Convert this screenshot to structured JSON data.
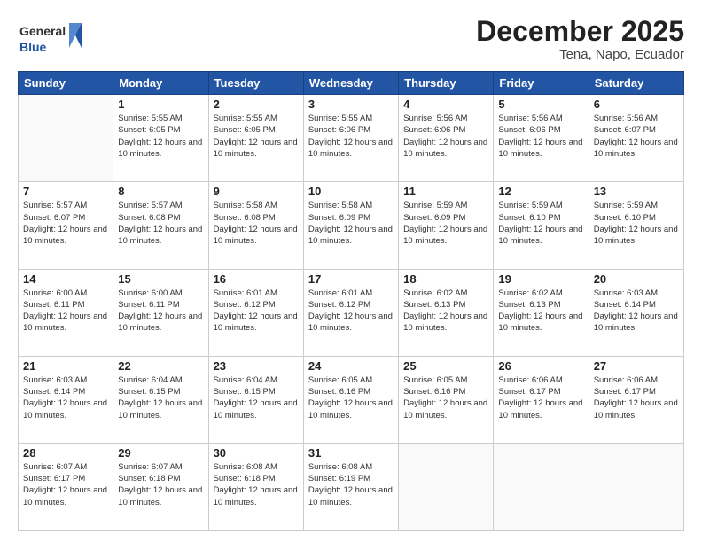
{
  "header": {
    "logo_general": "General",
    "logo_blue": "Blue",
    "month": "December 2025",
    "location": "Tena, Napo, Ecuador"
  },
  "days_of_week": [
    "Sunday",
    "Monday",
    "Tuesday",
    "Wednesday",
    "Thursday",
    "Friday",
    "Saturday"
  ],
  "weeks": [
    [
      {
        "day": "",
        "info": ""
      },
      {
        "day": "1",
        "info": "Sunrise: 5:55 AM\nSunset: 6:05 PM\nDaylight: 12 hours and 10 minutes."
      },
      {
        "day": "2",
        "info": "Sunrise: 5:55 AM\nSunset: 6:05 PM\nDaylight: 12 hours and 10 minutes."
      },
      {
        "day": "3",
        "info": "Sunrise: 5:55 AM\nSunset: 6:06 PM\nDaylight: 12 hours and 10 minutes."
      },
      {
        "day": "4",
        "info": "Sunrise: 5:56 AM\nSunset: 6:06 PM\nDaylight: 12 hours and 10 minutes."
      },
      {
        "day": "5",
        "info": "Sunrise: 5:56 AM\nSunset: 6:06 PM\nDaylight: 12 hours and 10 minutes."
      },
      {
        "day": "6",
        "info": "Sunrise: 5:56 AM\nSunset: 6:07 PM\nDaylight: 12 hours and 10 minutes."
      }
    ],
    [
      {
        "day": "7",
        "info": "Sunrise: 5:57 AM\nSunset: 6:07 PM\nDaylight: 12 hours and 10 minutes."
      },
      {
        "day": "8",
        "info": "Sunrise: 5:57 AM\nSunset: 6:08 PM\nDaylight: 12 hours and 10 minutes."
      },
      {
        "day": "9",
        "info": "Sunrise: 5:58 AM\nSunset: 6:08 PM\nDaylight: 12 hours and 10 minutes."
      },
      {
        "day": "10",
        "info": "Sunrise: 5:58 AM\nSunset: 6:09 PM\nDaylight: 12 hours and 10 minutes."
      },
      {
        "day": "11",
        "info": "Sunrise: 5:59 AM\nSunset: 6:09 PM\nDaylight: 12 hours and 10 minutes."
      },
      {
        "day": "12",
        "info": "Sunrise: 5:59 AM\nSunset: 6:10 PM\nDaylight: 12 hours and 10 minutes."
      },
      {
        "day": "13",
        "info": "Sunrise: 5:59 AM\nSunset: 6:10 PM\nDaylight: 12 hours and 10 minutes."
      }
    ],
    [
      {
        "day": "14",
        "info": "Sunrise: 6:00 AM\nSunset: 6:11 PM\nDaylight: 12 hours and 10 minutes."
      },
      {
        "day": "15",
        "info": "Sunrise: 6:00 AM\nSunset: 6:11 PM\nDaylight: 12 hours and 10 minutes."
      },
      {
        "day": "16",
        "info": "Sunrise: 6:01 AM\nSunset: 6:12 PM\nDaylight: 12 hours and 10 minutes."
      },
      {
        "day": "17",
        "info": "Sunrise: 6:01 AM\nSunset: 6:12 PM\nDaylight: 12 hours and 10 minutes."
      },
      {
        "day": "18",
        "info": "Sunrise: 6:02 AM\nSunset: 6:13 PM\nDaylight: 12 hours and 10 minutes."
      },
      {
        "day": "19",
        "info": "Sunrise: 6:02 AM\nSunset: 6:13 PM\nDaylight: 12 hours and 10 minutes."
      },
      {
        "day": "20",
        "info": "Sunrise: 6:03 AM\nSunset: 6:14 PM\nDaylight: 12 hours and 10 minutes."
      }
    ],
    [
      {
        "day": "21",
        "info": "Sunrise: 6:03 AM\nSunset: 6:14 PM\nDaylight: 12 hours and 10 minutes."
      },
      {
        "day": "22",
        "info": "Sunrise: 6:04 AM\nSunset: 6:15 PM\nDaylight: 12 hours and 10 minutes."
      },
      {
        "day": "23",
        "info": "Sunrise: 6:04 AM\nSunset: 6:15 PM\nDaylight: 12 hours and 10 minutes."
      },
      {
        "day": "24",
        "info": "Sunrise: 6:05 AM\nSunset: 6:16 PM\nDaylight: 12 hours and 10 minutes."
      },
      {
        "day": "25",
        "info": "Sunrise: 6:05 AM\nSunset: 6:16 PM\nDaylight: 12 hours and 10 minutes."
      },
      {
        "day": "26",
        "info": "Sunrise: 6:06 AM\nSunset: 6:17 PM\nDaylight: 12 hours and 10 minutes."
      },
      {
        "day": "27",
        "info": "Sunrise: 6:06 AM\nSunset: 6:17 PM\nDaylight: 12 hours and 10 minutes."
      }
    ],
    [
      {
        "day": "28",
        "info": "Sunrise: 6:07 AM\nSunset: 6:17 PM\nDaylight: 12 hours and 10 minutes."
      },
      {
        "day": "29",
        "info": "Sunrise: 6:07 AM\nSunset: 6:18 PM\nDaylight: 12 hours and 10 minutes."
      },
      {
        "day": "30",
        "info": "Sunrise: 6:08 AM\nSunset: 6:18 PM\nDaylight: 12 hours and 10 minutes."
      },
      {
        "day": "31",
        "info": "Sunrise: 6:08 AM\nSunset: 6:19 PM\nDaylight: 12 hours and 10 minutes."
      },
      {
        "day": "",
        "info": ""
      },
      {
        "day": "",
        "info": ""
      },
      {
        "day": "",
        "info": ""
      }
    ]
  ]
}
